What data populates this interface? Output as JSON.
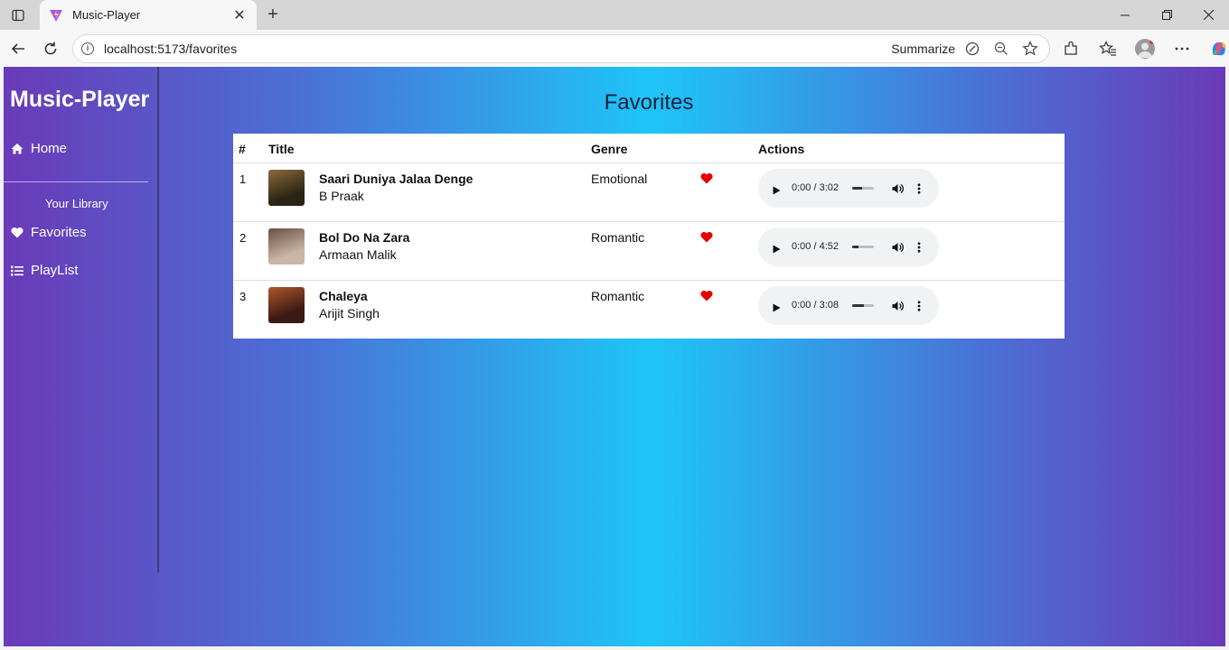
{
  "browser": {
    "tab_title": "Music-Player",
    "url": "localhost:5173/favorites",
    "summarize_label": "Summarize"
  },
  "sidebar": {
    "brand": "Music-Player",
    "home_label": "Home",
    "section_label": "Your Library",
    "favorites_label": "Favorites",
    "playlist_label": "PlayList"
  },
  "main": {
    "title": "Favorites",
    "columns": {
      "num": "#",
      "title": "Title",
      "genre": "Genre",
      "actions": "Actions"
    },
    "rows": [
      {
        "num": "1",
        "title": "Saari Duniya Jalaa Denge",
        "artist": "B Praak",
        "genre": "Emotional",
        "time": "0:00 / 3:02",
        "volume": 0.45,
        "cover_colors": [
          "#2b2412",
          "#8a6a3a"
        ]
      },
      {
        "num": "2",
        "title": "Bol Do Na Zara",
        "artist": "Armaan Malik",
        "genre": "Romantic",
        "time": "0:00 / 4:52",
        "volume": 0.3,
        "cover_colors": [
          "#c9b6a6",
          "#6a4e44"
        ]
      },
      {
        "num": "3",
        "title": "Chaleya",
        "artist": "Arijit Singh",
        "genre": "Romantic",
        "time": "0:00 / 3:08",
        "volume": 0.55,
        "cover_colors": [
          "#3a1a14",
          "#b0552c"
        ]
      }
    ]
  },
  "colors": {
    "heart": "#e60000",
    "title_text": "#14213d"
  }
}
